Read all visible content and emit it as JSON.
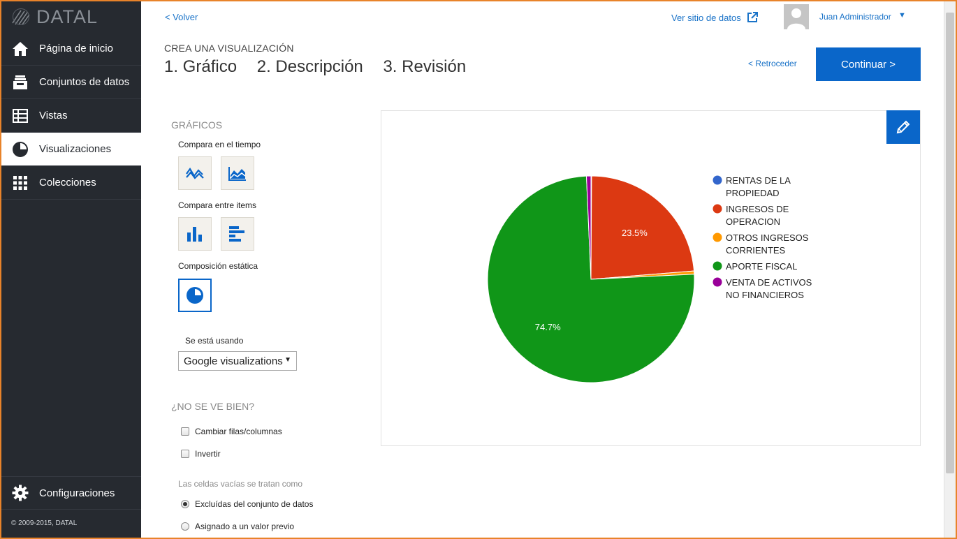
{
  "app": {
    "logo_text": "DATAL"
  },
  "sidebar": {
    "items": [
      {
        "label": "Página de inicio",
        "icon": "home-icon"
      },
      {
        "label": "Conjuntos de datos",
        "icon": "inbox-icon"
      },
      {
        "label": "Vistas",
        "icon": "table-icon"
      },
      {
        "label": "Visualizaciones",
        "icon": "pie-icon",
        "active": true
      },
      {
        "label": "Colecciones",
        "icon": "grid-icon"
      }
    ],
    "settings_label": "Configuraciones",
    "copyright": "© 2009-2015, DATAL"
  },
  "header": {
    "back_label": "< Volver",
    "view_site_label": "Ver sitio de datos",
    "user_name": "Juan Administrador",
    "user_caret": "▼"
  },
  "wizard": {
    "subtitle": "CREA UNA VISUALIZACIÓN",
    "steps": [
      "1. Gráfico",
      "2. Descripción",
      "3. Revisión"
    ],
    "back_label": "< Retroceder",
    "continue_label": "Continuar >"
  },
  "controls": {
    "graficos_title": "GRÁFICOS",
    "groups": [
      {
        "label": "Compara en el tiempo"
      },
      {
        "label": "Compara entre items"
      },
      {
        "label": "Composición estática"
      }
    ],
    "usando_label": "Se está usando",
    "library_selected": "Google visualizations",
    "select_caret": "▼",
    "nosevebien_title": "¿NO SE VE BIEN?",
    "swap_label": "Cambiar filas/columnas",
    "invert_label": "Invertir",
    "empty_cells_label": "Las celdas vacías se tratan como",
    "empty_options": [
      {
        "label": "Excluídas del conjunto de datos",
        "selected": true
      },
      {
        "label": "Asignado a un valor previo",
        "selected": false
      }
    ]
  },
  "colors": {
    "accent": "#0a66c9",
    "sidebar_bg": "#262a30"
  },
  "chart_data": {
    "type": "pie",
    "slices": [
      {
        "name": "RENTAS DE LA PROPIEDAD",
        "value": 0.1,
        "color": "#3366cc",
        "label": ""
      },
      {
        "name": "INGRESOS DE OPERACION",
        "value": 23.5,
        "color": "#dc3912",
        "label": "23.5%"
      },
      {
        "name": "OTROS INGRESOS CORRIENTES",
        "value": 0.5,
        "color": "#ff9900",
        "label": ""
      },
      {
        "name": "APORTE FISCAL",
        "value": 74.7,
        "color": "#109618",
        "label": "74.7%"
      },
      {
        "name": "VENTA DE ACTIVOS NO FINANCIEROS",
        "value": 0.7,
        "color": "#990099",
        "label": ""
      }
    ],
    "legend": [
      {
        "lines": [
          "RENTAS DE LA",
          "PROPIEDAD"
        ],
        "color": "#3366cc"
      },
      {
        "lines": [
          "INGRESOS DE",
          "OPERACION"
        ],
        "color": "#dc3912"
      },
      {
        "lines": [
          "OTROS INGRESOS",
          "CORRIENTES"
        ],
        "color": "#ff9900"
      },
      {
        "lines": [
          "APORTE FISCAL"
        ],
        "color": "#109618"
      },
      {
        "lines": [
          "VENTA DE ACTIVOS",
          "NO FINANCIEROS"
        ],
        "color": "#990099"
      }
    ],
    "legend_position": "right"
  }
}
